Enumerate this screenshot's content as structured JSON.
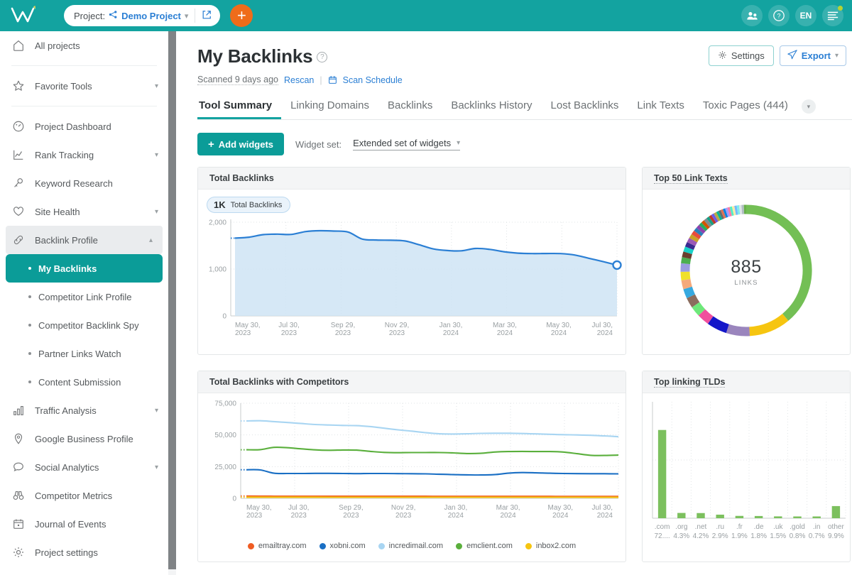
{
  "topbar": {
    "logo_name": "wf-logo",
    "project_label": "Project:",
    "project_name": "Demo Project",
    "project_chevron": "⌄",
    "open_external_icon": "external-link-icon",
    "add_button": "+",
    "users_icon": "users-icon",
    "help_icon": "question-icon",
    "lang": "EN",
    "menu_icon": "hamburger-icon"
  },
  "sidebar": {
    "items": [
      {
        "label": "All projects",
        "icon": "home-icon",
        "expandable": false
      },
      {
        "label": "Favorite Tools",
        "icon": "star-icon",
        "expandable": true
      },
      {
        "label": "Project Dashboard",
        "icon": "gauge-icon",
        "expandable": false
      },
      {
        "label": "Rank Tracking",
        "icon": "line-chart-icon",
        "expandable": true
      },
      {
        "label": "Keyword Research",
        "icon": "key-icon",
        "expandable": false
      },
      {
        "label": "Site Health",
        "icon": "heart-pulse-icon",
        "expandable": true
      },
      {
        "label": "Backlink Profile",
        "icon": "link-icon",
        "expandable": true,
        "expanded": true
      }
    ],
    "sub_items": [
      {
        "label": "My Backlinks",
        "selected": true
      },
      {
        "label": "Competitor Link Profile",
        "selected": false
      },
      {
        "label": "Competitor Backlink Spy",
        "selected": false
      },
      {
        "label": "Partner Links Watch",
        "selected": false
      },
      {
        "label": "Content Submission",
        "selected": false
      }
    ],
    "items_bottom": [
      {
        "label": "Traffic Analysis",
        "icon": "bar-chart-icon",
        "expandable": true
      },
      {
        "label": "Google Business Profile",
        "icon": "map-pin-icon",
        "expandable": false
      },
      {
        "label": "Social Analytics",
        "icon": "chat-icon",
        "expandable": true
      },
      {
        "label": "Competitor Metrics",
        "icon": "binoculars-icon",
        "expandable": false
      },
      {
        "label": "Journal of Events",
        "icon": "calendar-icon",
        "expandable": false
      },
      {
        "label": "Project settings",
        "icon": "gear-icon",
        "expandable": false
      }
    ]
  },
  "page": {
    "title": "My Backlinks",
    "help_icon": "question-icon",
    "scanned_text": "Scanned 9 days ago",
    "rescan_label": "Rescan",
    "separator": "|",
    "scan_schedule_label": "Scan Schedule",
    "scan_schedule_icon": "calendar-icon",
    "settings_label": "Settings",
    "settings_icon": "gear-icon",
    "export_label": "Export",
    "export_icon": "paper-plane-icon",
    "export_chevron": "⌄"
  },
  "tabs": [
    {
      "label": "Tool Summary",
      "active": true
    },
    {
      "label": "Linking Domains",
      "active": false
    },
    {
      "label": "Backlinks",
      "active": false
    },
    {
      "label": "Backlinks History",
      "active": false
    },
    {
      "label": "Lost Backlinks",
      "active": false
    },
    {
      "label": "Link Texts",
      "active": false
    },
    {
      "label": "Toxic Pages (444)",
      "active": false
    }
  ],
  "tabs_more_icon": "chevron-down-icon",
  "widgetbar": {
    "add_widgets_label": "Add widgets",
    "add_icon": "+",
    "widget_set_label": "Widget set:",
    "widget_set_value": "Extended set of widgets",
    "chevron": "⌄"
  },
  "widgets": {
    "total_backlinks": {
      "title": "Total Backlinks",
      "badge_value": "1K",
      "badge_label": "Total Backlinks"
    },
    "top_link_texts": {
      "title": "Top 50 Link Texts",
      "center_value": "885",
      "center_label": "LINKS"
    },
    "competitors": {
      "title": "Total Backlinks with Competitors"
    },
    "top_tlds": {
      "title": "Top linking TLDs"
    }
  },
  "colors": {
    "brand_teal": "#13a3a0",
    "accent_orange": "#ef6c1a",
    "link_blue": "#2b7fd4",
    "green": "#73bf55",
    "yellow": "#f6c510"
  },
  "chart_data": [
    {
      "type": "area",
      "id": "total-backlinks",
      "title": "Total Backlinks",
      "xlabel": "",
      "ylabel": "",
      "ylim": [
        0,
        2000
      ],
      "yticks": [
        0,
        1000,
        2000
      ],
      "ytick_labels": [
        "0",
        "1,000",
        "2,000"
      ],
      "grid": true,
      "x_tick_labels": [
        "May 30,\n2023",
        "Jul 30,\n2023",
        "Sep 29,\n2023",
        "Nov 29,\n2023",
        "Jan 30,\n2024",
        "Mar 30,\n2024",
        "May 30,\n2024",
        "Jul 30,\n2024"
      ],
      "series": [
        {
          "name": "Total Backlinks",
          "color": "#2b7fd4",
          "fill": "#cfe4f5",
          "values": [
            1660,
            1680,
            1735,
            1745,
            1740,
            1800,
            1818,
            1810,
            1790,
            1640,
            1620,
            1615,
            1600,
            1520,
            1430,
            1395,
            1390,
            1440,
            1420,
            1370,
            1340,
            1330,
            1332,
            1330,
            1300,
            1230,
            1160,
            1085
          ]
        }
      ],
      "endpoint_marker": {
        "value": 1085,
        "label": "1K"
      }
    },
    {
      "type": "pie",
      "id": "top-50-link-texts",
      "title": "Top 50 Link Texts",
      "center_value": 885,
      "center_label": "LINKS",
      "donut": true,
      "slices": [
        {
          "value": 335,
          "color": "#73bf55"
        },
        {
          "value": 88,
          "color": "#f6c510"
        },
        {
          "value": 50,
          "color": "#9a85bd"
        },
        {
          "value": 43,
          "color": "#1417c9"
        },
        {
          "value": 26,
          "color": "#f04f9d"
        },
        {
          "value": 22,
          "color": "#6ee87a"
        },
        {
          "value": 22,
          "color": "#8b6d5e"
        },
        {
          "value": 20,
          "color": "#36a9e0"
        },
        {
          "value": 19,
          "color": "#f5a97b"
        },
        {
          "value": 18,
          "color": "#f0e02a"
        },
        {
          "value": 18,
          "color": "#9a9ce0"
        },
        {
          "value": 13,
          "color": "#4caf50"
        },
        {
          "value": 12,
          "color": "#6b3f2e"
        },
        {
          "value": 11,
          "color": "#1ad1c8"
        },
        {
          "value": 10,
          "color": "#3b2a8f"
        },
        {
          "value": 10,
          "color": "#9b59b6"
        },
        {
          "value": 9,
          "color": "#c9a227"
        },
        {
          "value": 9,
          "color": "#e84c3d"
        },
        {
          "value": 8,
          "color": "#2980b9"
        },
        {
          "value": 8,
          "color": "#8e44ad"
        },
        {
          "value": 7,
          "color": "#27ae60"
        },
        {
          "value": 7,
          "color": "#d35400"
        },
        {
          "value": 7,
          "color": "#7f8c8d"
        },
        {
          "value": 6,
          "color": "#16a085"
        },
        {
          "value": 6,
          "color": "#c0392b"
        },
        {
          "value": 6,
          "color": "#6c5ce7"
        },
        {
          "value": 6,
          "color": "#b8a94a"
        },
        {
          "value": 5,
          "color": "#00b894"
        },
        {
          "value": 5,
          "color": "#636e72"
        },
        {
          "value": 5,
          "color": "#e17055"
        },
        {
          "value": 5,
          "color": "#0984e3"
        },
        {
          "value": 5,
          "color": "#a29bfe"
        },
        {
          "value": 5,
          "color": "#fd79a8"
        },
        {
          "value": 5,
          "color": "#55efc4"
        },
        {
          "value": 5,
          "color": "#ffeaa7"
        },
        {
          "value": 5,
          "color": "#74b9ff"
        },
        {
          "value": 5,
          "color": "#81ecec"
        },
        {
          "value": 5,
          "color": "#dfe6e9"
        },
        {
          "value": 5,
          "color": "#b2bec3"
        },
        {
          "value": 5,
          "color": "#6ab04c"
        }
      ]
    },
    {
      "type": "line",
      "id": "total-backlinks-with-competitors",
      "title": "Total Backlinks with Competitors",
      "ylim": [
        0,
        75000
      ],
      "yticks": [
        0,
        25000,
        50000,
        75000
      ],
      "ytick_labels": [
        "0",
        "25,000",
        "50,000",
        "75,000"
      ],
      "grid": true,
      "legend_position": "bottom",
      "x_tick_labels": [
        "May 30,\n2023",
        "Jul 30,\n2023",
        "Sep 29,\n2023",
        "Nov 29,\n2023",
        "Jan 30,\n2024",
        "Mar 30,\n2024",
        "May 30,\n2024",
        "Jul 30,\n2024"
      ],
      "series": [
        {
          "name": "emailtray.com",
          "color": "#ef5c23",
          "values": [
            1800,
            1750,
            1700,
            1700,
            1680,
            1680,
            1670,
            1660,
            1650,
            1640,
            1630,
            1620,
            1610,
            1600,
            1590,
            1580,
            1570,
            1560,
            1560,
            1555,
            1550,
            1545,
            1540,
            1535,
            1530,
            1525,
            1520,
            1500
          ]
        },
        {
          "name": "xobni.com",
          "color": "#1a6fc4",
          "values": [
            22500,
            22400,
            19800,
            19600,
            19600,
            19700,
            19700,
            19600,
            19500,
            19600,
            19600,
            19500,
            19400,
            19300,
            19000,
            18700,
            18500,
            18400,
            18700,
            19800,
            20300,
            20100,
            19800,
            19600,
            19500,
            19400,
            19400,
            19300
          ]
        },
        {
          "name": "incredimail.com",
          "color": "#a8d5f2",
          "values": [
            61000,
            61200,
            60500,
            59800,
            59000,
            58200,
            57800,
            57500,
            57300,
            56600,
            55300,
            54000,
            53000,
            51800,
            50900,
            50700,
            50900,
            51200,
            51300,
            51300,
            51100,
            50800,
            50500,
            50200,
            50000,
            49700,
            49200,
            48600
          ]
        },
        {
          "name": "emclient.com",
          "color": "#5aaf3c",
          "values": [
            38300,
            38400,
            40200,
            39900,
            39000,
            38200,
            37900,
            38100,
            38000,
            37000,
            36200,
            36000,
            36100,
            36100,
            36100,
            35800,
            35300,
            35500,
            36500,
            36900,
            37000,
            36900,
            36900,
            36500,
            35200,
            33900,
            33800,
            34100
          ]
        },
        {
          "name": "inbox2.com",
          "color": "#f6c510",
          "values": [
            900,
            900,
            880,
            880,
            870,
            870,
            860,
            860,
            855,
            850,
            850,
            845,
            845,
            840,
            840,
            835,
            835,
            830,
            830,
            825,
            825,
            820,
            820,
            815,
            815,
            810,
            810,
            800
          ]
        }
      ]
    },
    {
      "type": "bar",
      "id": "top-linking-tlds",
      "title": "Top linking TLDs",
      "categories": [
        ".com",
        ".org",
        ".net",
        ".ru",
        ".fr",
        ".de",
        ".uk",
        ".gold",
        ".in",
        "other"
      ],
      "pct_labels": [
        "72....",
        "4.3%",
        "4.2%",
        "2.9%",
        "1.9%",
        "1.8%",
        "1.5%",
        "0.8%",
        "0.7%",
        "9.9%"
      ],
      "values": [
        72.0,
        4.3,
        4.2,
        2.9,
        1.9,
        1.8,
        1.5,
        0.8,
        0.7,
        9.9
      ],
      "color": "#7cc05e",
      "ylim": [
        0,
        95
      ],
      "grid": true
    }
  ]
}
